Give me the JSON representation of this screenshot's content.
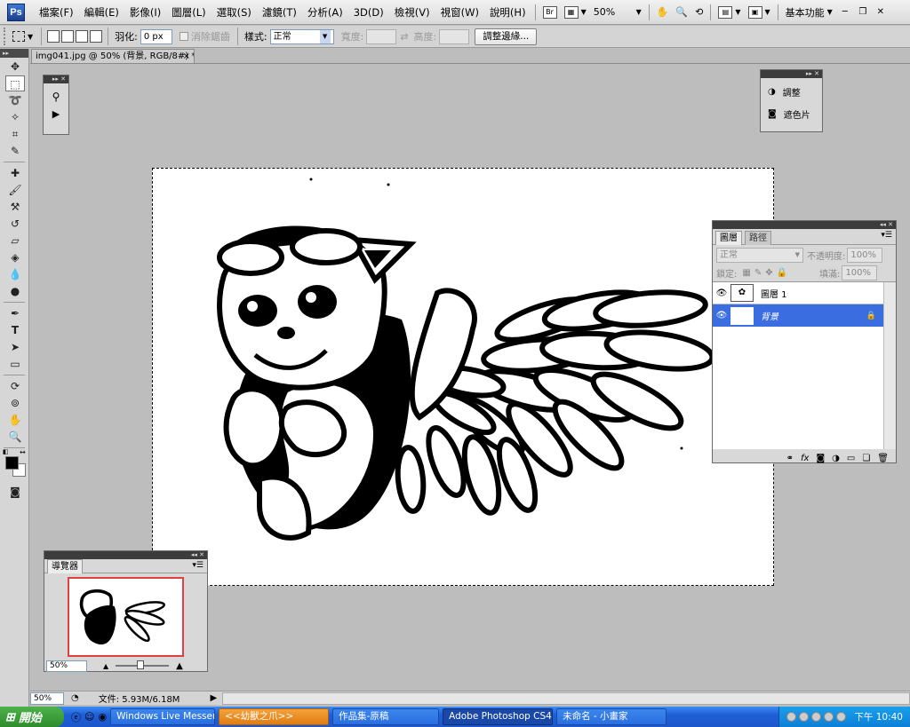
{
  "menu": {
    "items": [
      "檔案(F)",
      "編輯(E)",
      "影像(I)",
      "圖層(L)",
      "選取(S)",
      "濾鏡(T)",
      "分析(A)",
      "3D(D)",
      "檢視(V)",
      "視窗(W)",
      "說明(H)"
    ],
    "zoom": "50%",
    "bridge_label": "Br",
    "workspace": "基本功能"
  },
  "options": {
    "feather_label": "羽化:",
    "feather_value": "0 px",
    "antialias_label": "消除鋸齒",
    "style_label": "樣式:",
    "style_value": "正常",
    "width_label": "寬度:",
    "height_label": "高度:",
    "refine_button": "調整邊緣..."
  },
  "document": {
    "tab_title": "img041.jpg @ 50% (背景, RGB/8#) *",
    "close": "×"
  },
  "adjust_panel": {
    "items": [
      "調整",
      "遮色片"
    ]
  },
  "layers_panel": {
    "tabs": [
      "圖層",
      "路徑"
    ],
    "blend_mode": "正常",
    "opacity_label": "不透明度:",
    "opacity_value": "100%",
    "lock_label": "鎖定:",
    "fill_label": "填滿:",
    "fill_value": "100%",
    "layers": [
      {
        "name": "圖層 1",
        "selected": false
      },
      {
        "name": "背景",
        "selected": true
      }
    ]
  },
  "navigator": {
    "tab": "導覽器",
    "zoom": "50%"
  },
  "status": {
    "zoom": "50%",
    "doc_info": "文件: 5.93M/6.18M"
  },
  "taskbar": {
    "start": "開始",
    "tasks": [
      {
        "label": "Windows Live Messen...",
        "style": "normal"
      },
      {
        "label": "<<幼獸之爪>>",
        "style": "orange"
      },
      {
        "label": "作品集-原稿",
        "style": "normal"
      },
      {
        "label": "Adobe Photoshop CS4...",
        "style": "active"
      },
      {
        "label": "未命名 - 小畫家",
        "style": "normal"
      }
    ],
    "clock": "下午 10:40"
  },
  "colors": {
    "selection_blue": "#3a6ee0",
    "taskbar_blue": "#1f5fd6"
  }
}
